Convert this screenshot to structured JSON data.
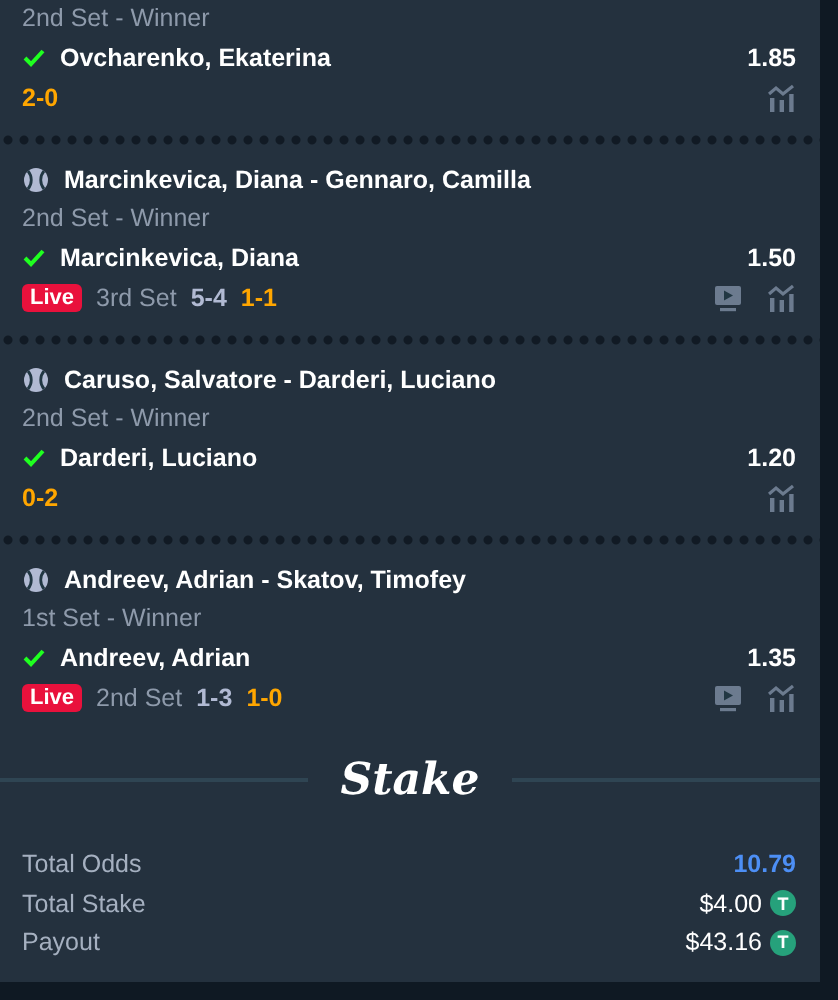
{
  "legs": [
    {
      "market": "2nd Set - Winner",
      "selection": "Ovcharenko, Ekaterina",
      "odds": "1.85",
      "won": true,
      "highlight_score": "2-0",
      "stream": false
    },
    {
      "event": "Marcinkevica, Diana - Gennaro, Camilla",
      "market": "2nd Set - Winner",
      "selection": "Marcinkevica, Diana",
      "odds": "1.50",
      "won": true,
      "live_label": "Live",
      "period": "3rd Set",
      "score": "5-4",
      "highlight_score": "1-1",
      "stream": true
    },
    {
      "event": "Caruso, Salvatore - Darderi, Luciano",
      "market": "2nd Set - Winner",
      "selection": "Darderi, Luciano",
      "odds": "1.20",
      "won": true,
      "highlight_score": "0-2",
      "stream": false
    },
    {
      "event": "Andreev, Adrian - Skatov, Timofey",
      "market": "1st Set - Winner",
      "selection": "Andreev, Adrian",
      "odds": "1.35",
      "won": true,
      "live_label": "Live",
      "period": "2nd Set",
      "score": "1-3",
      "highlight_score": "1-0",
      "stream": true
    }
  ],
  "logo": "Stake",
  "totals": [
    {
      "kind": "odds",
      "label": "Total Odds",
      "value": "10.79"
    },
    {
      "kind": "amount",
      "label": "Total Stake",
      "value": "$4.00",
      "coin": "T"
    },
    {
      "kind": "amount",
      "label": "Payout",
      "value": "$43.16",
      "coin": "T"
    }
  ]
}
